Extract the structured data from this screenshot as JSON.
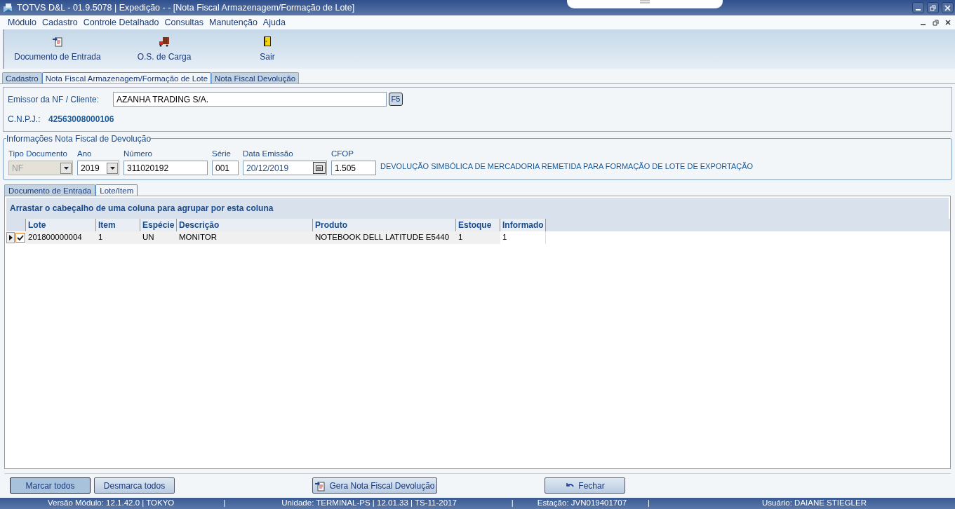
{
  "window": {
    "title": "TOTVS D&L - 01.9.5078 | Expedição - - [Nota Fiscal Armazenagem/Formação de Lote]"
  },
  "menu": [
    "Módulo",
    "Cadastro",
    "Controle Detalhado",
    "Consultas",
    "Manutenção",
    "Ajuda"
  ],
  "toolbar": [
    {
      "label": "Documento de Entrada",
      "kind": "document"
    },
    {
      "label": "O.S. de Carga",
      "kind": "cargo"
    },
    {
      "label": "Sair",
      "kind": "exit"
    }
  ],
  "tabs": [
    {
      "label": "Cadastro",
      "selected": false
    },
    {
      "label": "Nota Fiscal Armazenagem/Formação de Lote",
      "selected": true
    },
    {
      "label": "Nota Fiscal Devolução",
      "selected": false
    }
  ],
  "emitter": {
    "label": "Emissor da NF / Cliente:",
    "value": "AZANHA TRADING S/A.",
    "button": "F5",
    "cnpj_label": "C.N.P.J.:",
    "cnpj": "42563008000106"
  },
  "return_invoice": {
    "title": "Informações Nota Fiscal de Devolução",
    "fields": [
      {
        "label": "Tipo Documento",
        "value": "NF",
        "kind": "dropdown",
        "disabled": true
      },
      {
        "label": "Ano",
        "value": "2019",
        "kind": "dropdown"
      },
      {
        "label": "Número",
        "value": "311020192",
        "kind": "text"
      },
      {
        "label": "Série",
        "value": "001",
        "kind": "text"
      },
      {
        "label": "Data Emissão",
        "value": "20/12/2019",
        "kind": "date"
      },
      {
        "label": "CFOP",
        "value": "1.505",
        "kind": "text"
      }
    ],
    "cfop_description": "DEVOLUÇÃO SIMBÓLICA DE MERCADORIA REMETIDA PARA FORMAÇÃO DE LOTE DE EXPORTAÇÃO"
  },
  "sub_tabs": [
    {
      "label": "Documento de Entrada",
      "selected": false
    },
    {
      "label": "Lote/Item",
      "selected": true
    }
  ],
  "grid": {
    "group_hint": "Arrastar o cabeçalho de uma coluna para agrupar por esta coluna",
    "columns": [
      "Lote",
      "Item",
      "Espécie",
      "Descrição",
      "Produto",
      "Estoque",
      "Informado"
    ],
    "rows": [
      {
        "selected": true,
        "checked": true,
        "cells": [
          "201800000004",
          "1",
          "UN",
          "MONITOR",
          "NOTEBOOK DELL LATITUDE E5440",
          "1",
          "1"
        ]
      }
    ]
  },
  "buttons": [
    {
      "label": "Marcar todos",
      "kind": "plain"
    },
    {
      "label": "Desmarca todos",
      "kind": "plain"
    },
    {
      "label": "Gera Nota Fiscal Devolução",
      "kind": "document"
    },
    {
      "label": "Fechar",
      "kind": "undo"
    }
  ],
  "status_bar": [
    "Versão Módulo:  12.1.42.0  |  TOKYO",
    "|",
    "Unidade: TERMINAL-PS | 12.01.33 | TS-11-2017",
    "|",
    "Estação: JVN019401707",
    "|",
    "Usuário: DAIANE STIEGLER"
  ]
}
